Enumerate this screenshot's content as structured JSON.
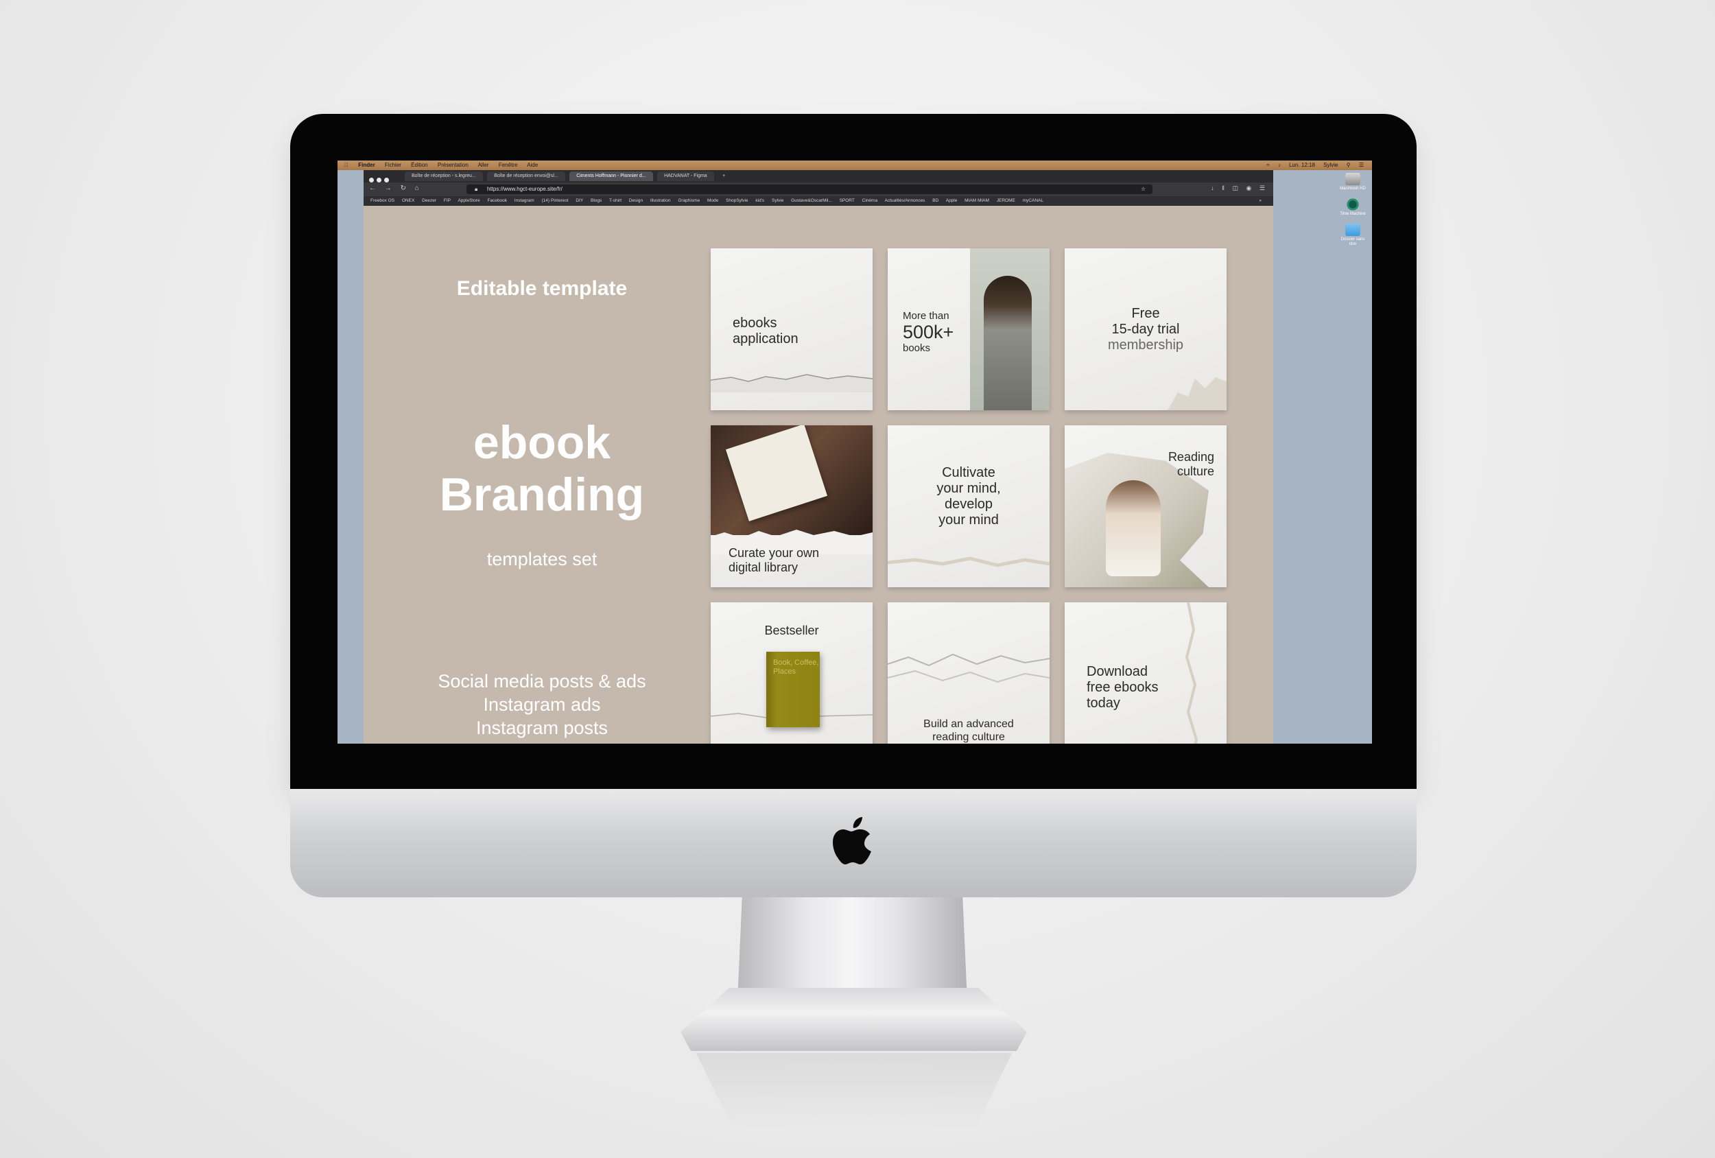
{
  "menubar": {
    "left_items": [
      "Finder",
      "Fichier",
      "Édition",
      "Présentation",
      "Aller",
      "Fenêtre",
      "Aide"
    ],
    "clock": "Lun. 12:18",
    "user": "Sylvie"
  },
  "desktop": {
    "icons": [
      "Macintosh HD",
      "Time Machine",
      "Dossier sans titre"
    ]
  },
  "browser": {
    "tabs": [
      {
        "label": "Boîte de réception - s.legreu..."
      },
      {
        "label": "Boîte de réception envoi@sl..."
      },
      {
        "label": "Ciments Hoffmann - Pionnier d..."
      },
      {
        "label": "HADVANAT - Figma"
      }
    ],
    "url": "https://www.hgct-europe.site/fr/",
    "bookmarks": [
      "Freebox OS",
      "ONEX",
      "Deezer",
      "FIP",
      "AppleStore",
      "Facebook",
      "Instagram",
      "(14) Pinterest",
      "DIY",
      "Blogs",
      "T-shirt",
      "Design",
      "Illustration",
      "Graphisme",
      "Mode",
      "ShopSylvie",
      "kid's",
      "Sylvie",
      "Gustave&OscarMil...",
      "SPORT",
      "Cinéma",
      "Actualités/Annonces",
      "BD",
      "Apple",
      "MIAM MIAM",
      "JEROME",
      "myCANAL"
    ]
  },
  "page": {
    "editable": "Editable template",
    "title_line1": "ebook",
    "title_line2": "Branding",
    "subtitle": "templates set",
    "features": [
      "Social media posts & ads",
      "Instagram ads",
      "Instagram posts"
    ],
    "tiles": {
      "t1": {
        "line1": "ebooks",
        "line2": "application"
      },
      "t2": {
        "small1": "More than",
        "big": "500k+",
        "small2": "books"
      },
      "t3": {
        "line1": "Free",
        "line2": "15-day trial",
        "line3": "membership"
      },
      "t4": {
        "line1": "Curate your own",
        "line2": "digital library"
      },
      "t5": {
        "line1": "Cultivate",
        "line2": "your mind,",
        "line3": "develop",
        "line4": "your mind"
      },
      "t6": {
        "line1": "Reading",
        "line2": "culture"
      },
      "t7": {
        "title": "Bestseller",
        "book": "Book, Coffee, Places"
      },
      "t8": {
        "line1": "Build an advanced",
        "line2": "reading culture"
      },
      "t9": {
        "line1": "Download",
        "line2": "free ebooks",
        "line3": "today"
      }
    }
  },
  "colors": {
    "page_bg": "#c5b9ae",
    "menubar": "#b8895a",
    "desktop": "#a7b4c3",
    "tile_bg": "#f1f0ee",
    "book_green": "#8e8313"
  },
  "icons": [
    "apple-logo-icon",
    "back-icon",
    "forward-icon",
    "reload-icon",
    "home-icon",
    "lock-icon",
    "star-icon",
    "download-icon"
  ]
}
